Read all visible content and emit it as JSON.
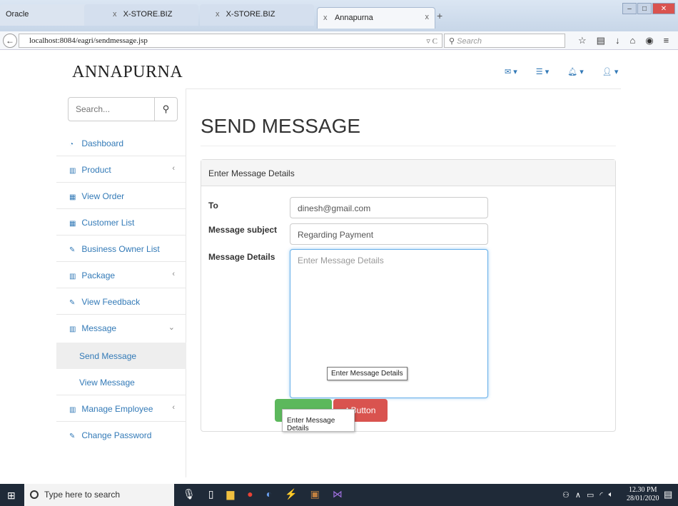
{
  "browser": {
    "tabs": [
      {
        "label": "Oracle",
        "close": "x"
      },
      {
        "label": "X-STORE.BIZ",
        "close": "x"
      },
      {
        "label": "X-STORE.BIZ",
        "close": "x"
      },
      {
        "label": "Annapurna",
        "close": "x"
      }
    ],
    "new_tab": "+",
    "url": "localhost:8084/eagri/sendmessage.jsp",
    "reload": "▿ C",
    "search_placeholder": "Search"
  },
  "app": {
    "brand": "ANNAPURNA"
  },
  "sidebar": {
    "search_placeholder": "Search...",
    "items": [
      {
        "label": "Dashboard",
        "icon": "dashboard-icon"
      },
      {
        "label": "Product",
        "icon": "bar-chart-icon",
        "caret": "‹"
      },
      {
        "label": "View Order",
        "icon": "table-icon"
      },
      {
        "label": "Customer List",
        "icon": "table-icon"
      },
      {
        "label": "Business Owner List",
        "icon": "edit-icon"
      },
      {
        "label": "Package",
        "icon": "bar-chart-icon",
        "caret": "‹"
      },
      {
        "label": "View Feedback",
        "icon": "edit-icon"
      },
      {
        "label": "Message",
        "icon": "bar-chart-icon",
        "caret": "⌄"
      },
      {
        "label": "Manage Employee",
        "icon": "bar-chart-icon",
        "caret": "‹"
      },
      {
        "label": "Change Password",
        "icon": "edit-icon"
      }
    ],
    "subitems": [
      {
        "label": "Send Message"
      },
      {
        "label": "View Message"
      }
    ]
  },
  "main": {
    "title": "SEND MESSAGE",
    "panel_heading": "Enter Message Details",
    "to_label": "To",
    "to_value": "dinesh@gmail.com",
    "subject_label": "Message subject",
    "subject_value": "Regarding Payment",
    "details_label": "Message Details",
    "details_placeholder": "Enter Message Details",
    "tooltip": "Enter Message Details",
    "reset_label": "Reset Button",
    "reset_visible": "t Button",
    "tooltip2": "Enter Message Details"
  },
  "taskbar": {
    "search_placeholder": "Type here to search",
    "time": "12.30 PM",
    "date": "28/01/2020"
  },
  "colors": {
    "link": "#337ab7",
    "submit": "#5cb85c",
    "reset": "#d9534f"
  }
}
